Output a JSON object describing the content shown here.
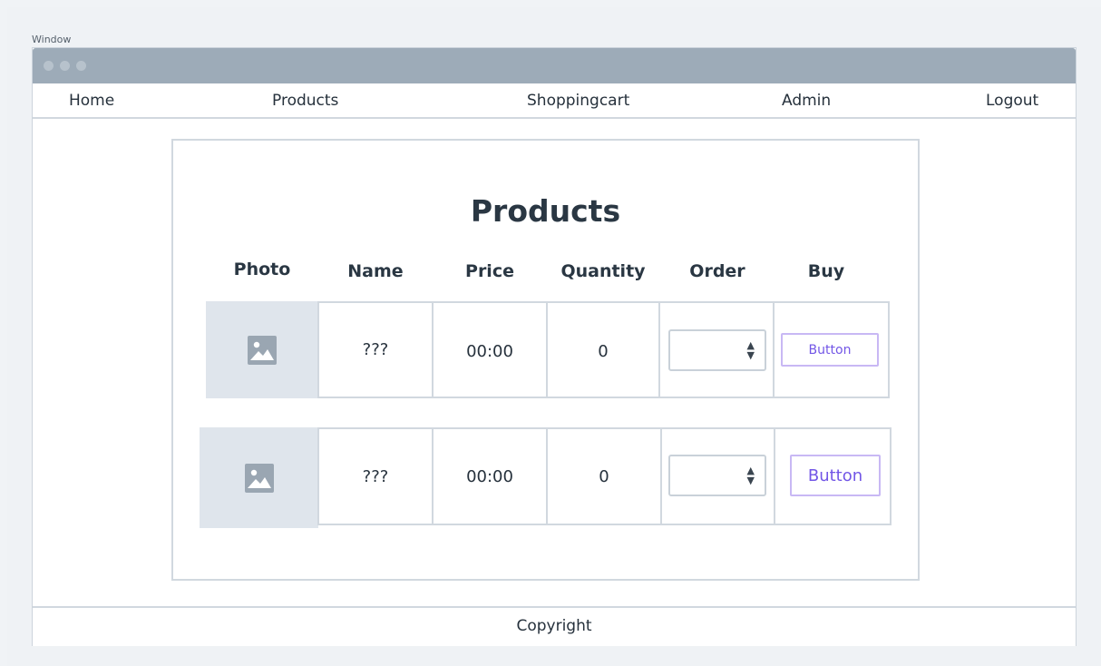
{
  "window": {
    "caption": "Window"
  },
  "nav": {
    "items": [
      {
        "label": "Home"
      },
      {
        "label": "Products"
      },
      {
        "label": "Shoppingcart"
      },
      {
        "label": "Admin"
      },
      {
        "label": "Logout"
      }
    ]
  },
  "main": {
    "title": "Products",
    "columns": [
      "Photo",
      "Name",
      "Price",
      "Quantity",
      "Order",
      "Buy"
    ],
    "rows": [
      {
        "name": "???",
        "price": "00:00",
        "quantity": "0",
        "order_value": "",
        "buy_label": "Button"
      },
      {
        "name": "???",
        "price": "00:00",
        "quantity": "0",
        "order_value": "",
        "buy_label": "Button"
      }
    ]
  },
  "footer": {
    "text": "Copyright"
  },
  "icons": {
    "photo": "image-placeholder-icon",
    "select": "select-arrows-icon"
  },
  "colors": {
    "titlebar": "#9dabb8",
    "accent": "#7256e6",
    "border": "#d1d8df",
    "photo_bg": "#dfe5ec"
  }
}
